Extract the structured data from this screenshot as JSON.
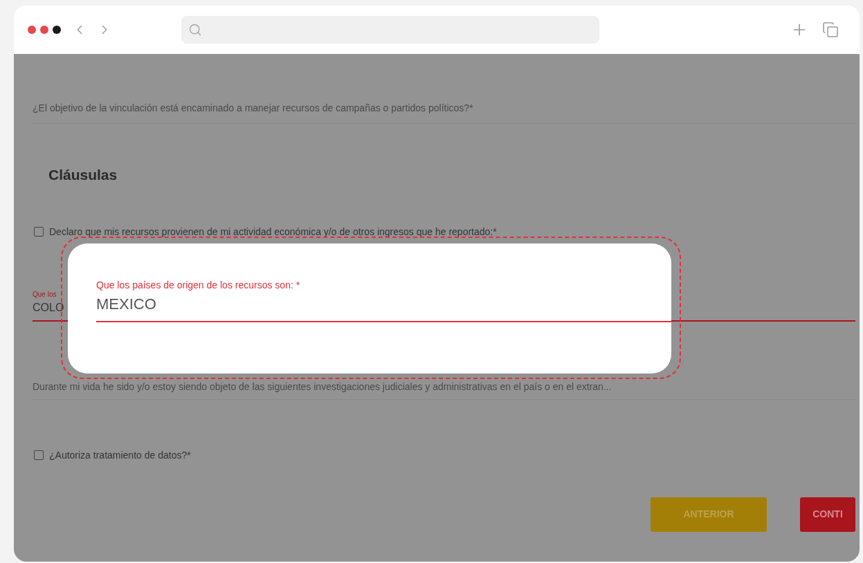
{
  "browser": {
    "traffic_lights": [
      {
        "color": "#e5484d"
      },
      {
        "color": "#e5484d"
      },
      {
        "color": "#1a1a1a"
      }
    ]
  },
  "form": {
    "question": "¿El objetivo de la vinculación está encaminado a manejar recursos de campañas o partidos políticos?*",
    "section_title": "Cláusulas",
    "declaration": {
      "label": "Declaro que mis recursos provienen de mi actividad económica y/o de otros ingresos que he reportado:*",
      "checked": false
    },
    "country_field": {
      "label": "Que los",
      "value": "COLO"
    },
    "investigations": "Durante mi vida he sido y/o estoy siendo objeto de las siguientes investigaciones judiciales y administrativas en el país o en el extran...",
    "consent": {
      "label": "¿Autoriza tratamiento de datos?*",
      "checked": false
    },
    "buttons": [
      {
        "label": "ANTERIOR",
        "kind": "secondary"
      },
      {
        "label": "CONTI",
        "kind": "primary"
      }
    ]
  },
  "dialog": {
    "label": "Que los países de origen de los recursos son: *",
    "value": "MEXICO"
  }
}
